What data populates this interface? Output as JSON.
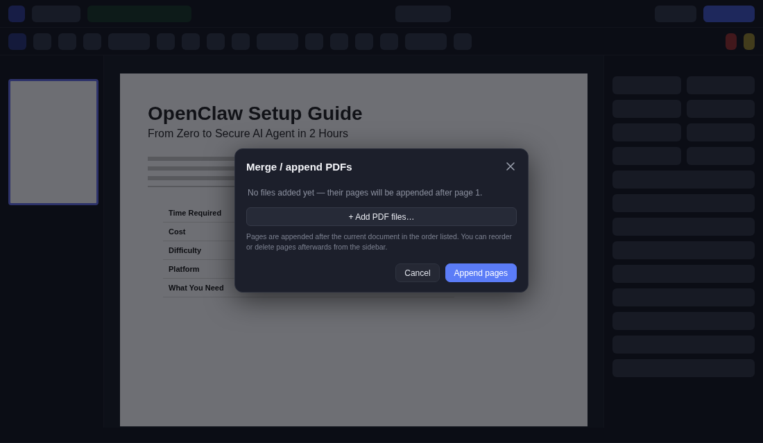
{
  "document": {
    "title": "OpenClaw Setup Guide",
    "subtitle": "From Zero to Secure AI Agent in 2 Hours",
    "table_rows": [
      "Time Required",
      "Cost",
      "Difficulty",
      "Platform",
      "What You Need"
    ]
  },
  "dialog": {
    "title": "Merge / append PDFs",
    "message": "No files added yet — their pages will be appended after page 1.",
    "add_button": "+ Add PDF files…",
    "hint": "Pages are appended after the current document in the order listed. You can reorder or delete pages afterwards from the sidebar.",
    "buttons": [
      {
        "label": "Cancel",
        "kind": "secondary"
      },
      {
        "label": "Append pages",
        "kind": "primary"
      }
    ]
  }
}
